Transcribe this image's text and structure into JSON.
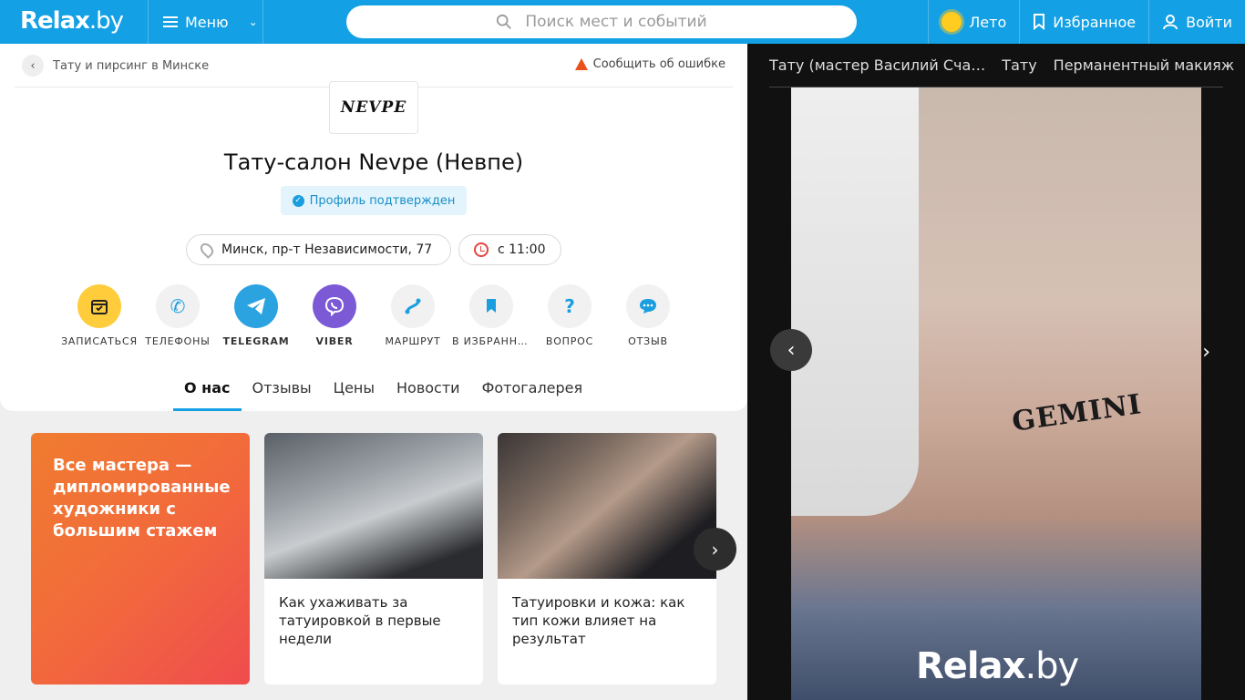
{
  "header": {
    "logo_main": "Relax",
    "logo_suffix": ".by",
    "menu_label": "Меню",
    "search_placeholder": "Поиск мест и событий",
    "season_label": "Лето",
    "favorites_label": "Избранное",
    "login_label": "Войти"
  },
  "breadcrumb": {
    "label": "Тату и пирсинг в Минске"
  },
  "report_label": "Сообщить об ошибке",
  "place": {
    "logo_text": "NEVPE",
    "title": "Тату-салон Nevpe (Невпе)",
    "verified_label": "Профиль подтвержден",
    "address": "Минск, пр-т Независимости, 77",
    "hours": "с 11:00"
  },
  "actions": [
    {
      "label": "ЗАПИСАТЬСЯ",
      "icon": "calendar-icon"
    },
    {
      "label": "ТЕЛЕФОНЫ",
      "icon": "phone-icon"
    },
    {
      "label": "TELEGRAM",
      "icon": "telegram-icon"
    },
    {
      "label": "VIBER",
      "icon": "viber-icon"
    },
    {
      "label": "МАРШРУТ",
      "icon": "route-icon"
    },
    {
      "label": "В ИЗБРАННОЕ",
      "icon": "bookmark-icon"
    },
    {
      "label": "ВОПРОС",
      "icon": "question-icon"
    },
    {
      "label": "ОТЗЫВ",
      "icon": "comment-icon"
    }
  ],
  "tabs": [
    {
      "label": "О нас",
      "active": true
    },
    {
      "label": "Отзывы"
    },
    {
      "label": "Цены"
    },
    {
      "label": "Новости"
    },
    {
      "label": "Фотогалерея"
    }
  ],
  "promo_text": "Все мастера — дипломированные художники с большим стажем",
  "articles": [
    {
      "title": "Как ухаживать за татуировкой в первые недели"
    },
    {
      "title": "Татуировки и кожа: как тип кожи влияет на результат"
    }
  ],
  "gallery": {
    "tabs": [
      "Тату (мастер Василий Сча…",
      "Тату",
      "Перманентный макияж"
    ],
    "tattoo_text": "GEMINI",
    "watermark_main": "Relax",
    "watermark_suffix": ".by"
  },
  "colors": {
    "brand": "#13a0e4",
    "promo_gradient_start": "#f07c2f",
    "promo_gradient_end": "#ef4c4e",
    "telegram": "#2aa3e0",
    "viber": "#7c5ad6",
    "booking": "#ffcc3b"
  }
}
